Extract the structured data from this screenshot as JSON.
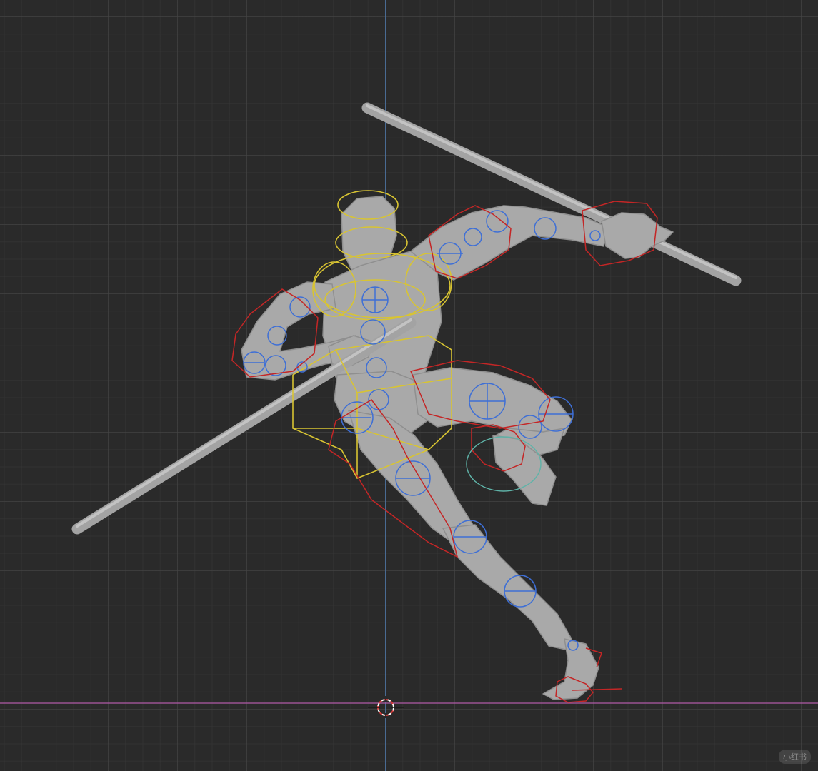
{
  "viewport": {
    "background": "#2a2a2a",
    "grid_color": "#464646",
    "axis_z_color": "#4f7fb8",
    "axis_x_color": "#b05aa8"
  },
  "scene": {
    "objects": [
      "mannequin",
      "staff",
      "armature-controls",
      "3d-cursor"
    ],
    "control_colors": {
      "fk": "#3e6fd6",
      "ik": "#c42626",
      "torso": "#d8c432",
      "pole": "#5fb3a8"
    },
    "mesh_color": "#a9a9a9",
    "staff_color": "#a3a3a3"
  },
  "watermark": {
    "text": "小红书",
    "icon": "watermark-badge"
  }
}
